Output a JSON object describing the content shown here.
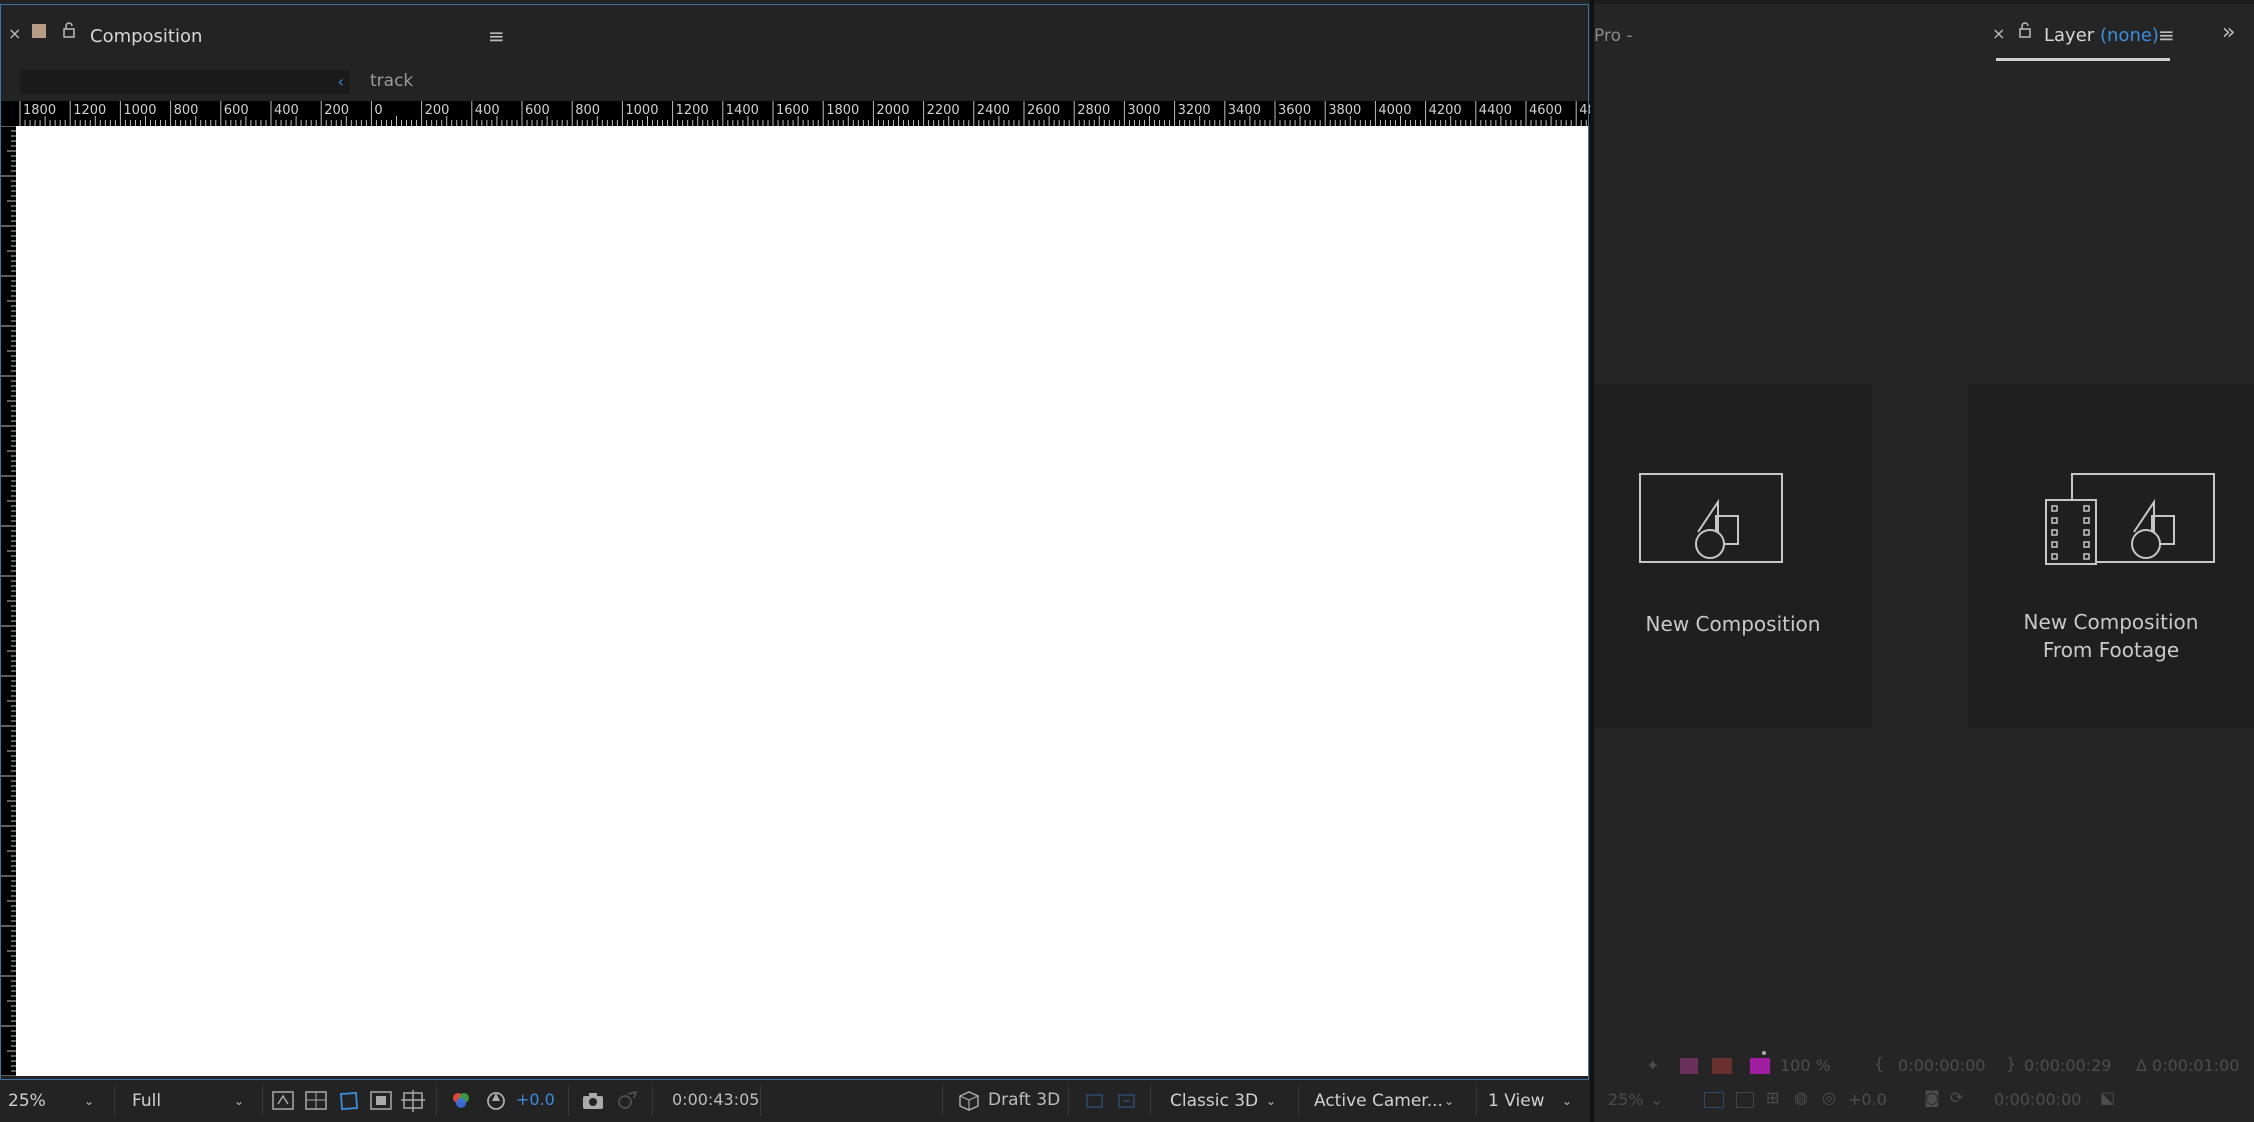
{
  "composition_panel": {
    "tab_title": "Composition",
    "flowchart_text": "track",
    "ruler_top_labels": [
      "1800",
      "1200",
      "1000",
      "800",
      "600",
      "400",
      "200",
      "0",
      "200",
      "400",
      "600",
      "800",
      "1000",
      "1200",
      "1400",
      "1600",
      "1800",
      "2000",
      "2200",
      "2400",
      "2600",
      "2800",
      "3000",
      "3200",
      "3400",
      "3600",
      "3800",
      "4000",
      "4200",
      "4400",
      "4600",
      "48"
    ],
    "toolbar": {
      "magnification": "25%",
      "resolution": "Full",
      "exposure": "+0.0",
      "timecode": "0:00:43:05",
      "draft3d": "Draft 3D",
      "renderer": "Classic 3D",
      "camera": "Active Camer...",
      "views": "1 View"
    }
  },
  "layer_panel": {
    "partial_tab": "Pro -",
    "tab_title": "Layer",
    "tab_value": "(none)",
    "tiles": {
      "new_comp": "New Composition",
      "from_footage_line1": "New Composition",
      "from_footage_line2": "From Footage"
    },
    "footer": {
      "opacity": "100 %",
      "in_point": "0:00:00:00",
      "out_point": "0:00:00:29",
      "duration": "Δ 0:00:01:00",
      "magnification": "25%",
      "exposure": "+0.0",
      "timecode": "0:00:00:00"
    }
  },
  "colors": {
    "accent_blue": "#3b8ddd",
    "panel_bg": "#232323",
    "viewer_bg": "#ffffff"
  }
}
